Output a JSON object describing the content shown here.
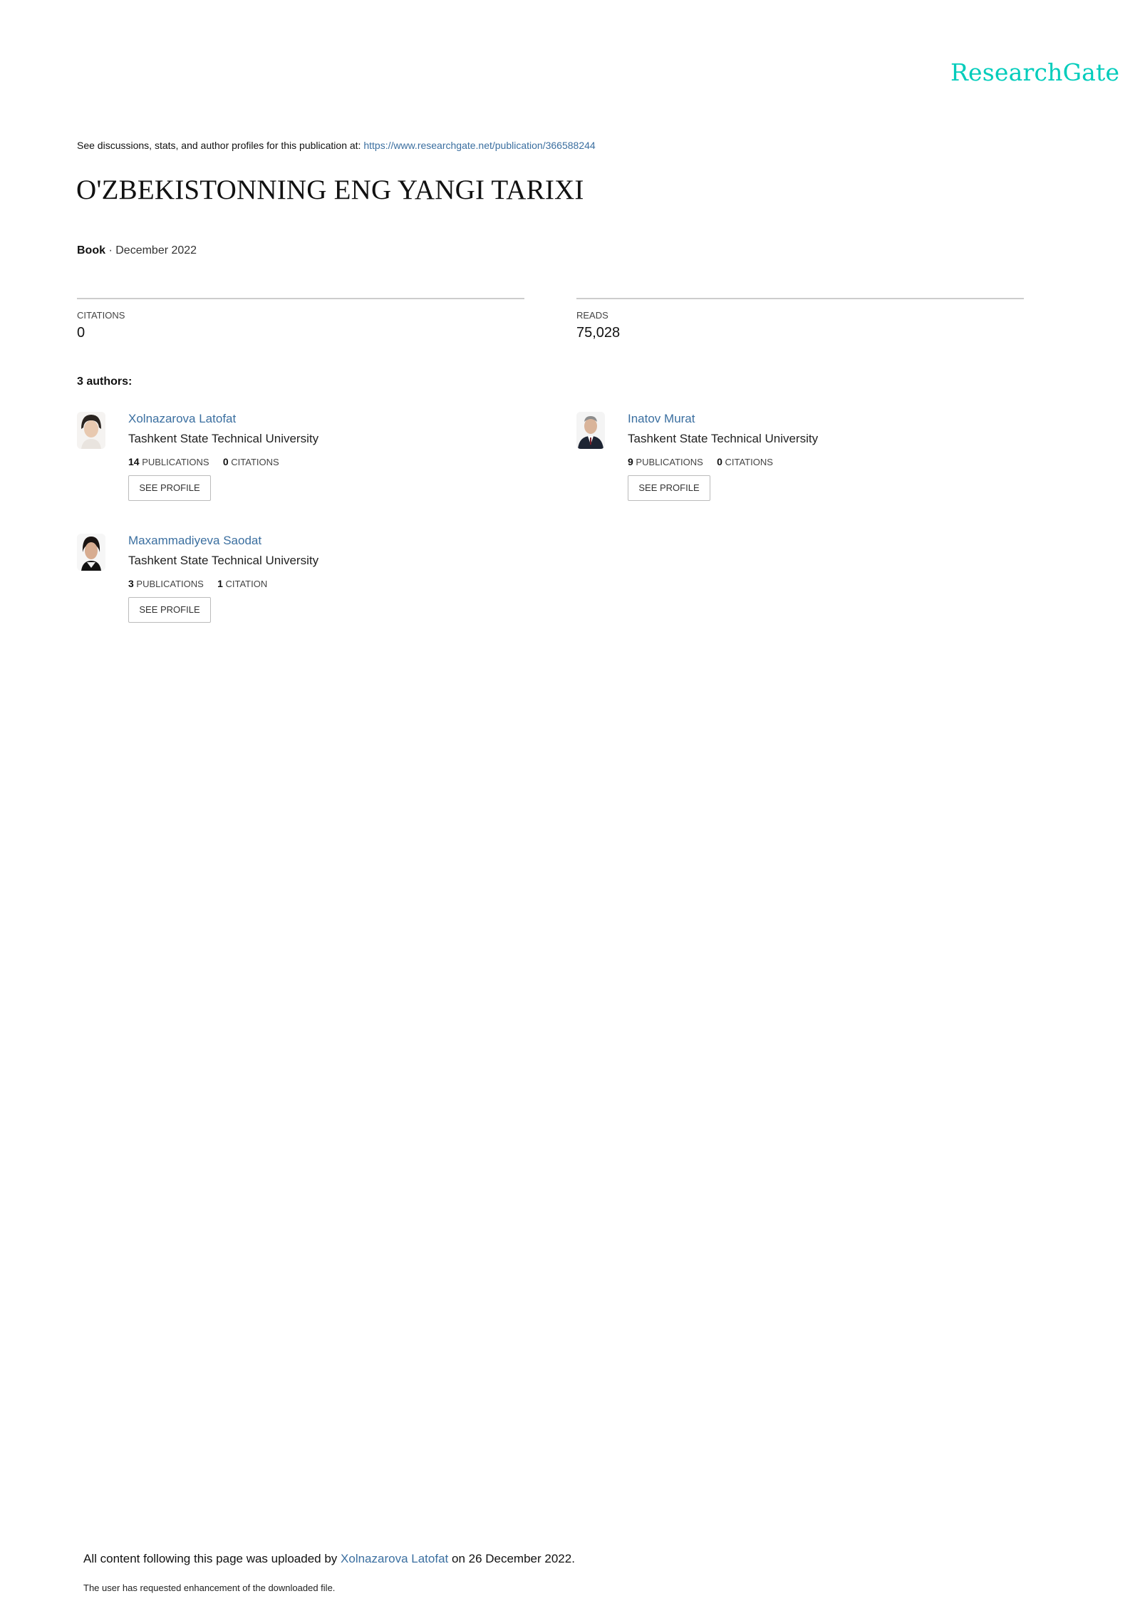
{
  "brand": {
    "logo": "ResearchGate",
    "color": "#00ccbb"
  },
  "header": {
    "discuss_text": "See discussions, stats, and author profiles for this publication at:",
    "url": "https://www.researchgate.net/publication/366588244"
  },
  "publication": {
    "title": "O'ZBEKISTONNING ENG YANGI TARIXI",
    "type": "Book",
    "separator": "·",
    "date": "December 2022"
  },
  "stats": {
    "citations_label": "CITATIONS",
    "citations_value": "0",
    "reads_label": "READS",
    "reads_value": "75,028"
  },
  "authors_heading": "3 authors:",
  "authors": [
    {
      "name": "Xolnazarova Latofat",
      "institution": "Tashkent State Technical University",
      "publications_count": "14",
      "publications_label": "PUBLICATIONS",
      "citations_count": "0",
      "citations_label": "CITATIONS",
      "button": "SEE PROFILE"
    },
    {
      "name": "Inatov Murat",
      "institution": "Tashkent State Technical University",
      "publications_count": "9",
      "publications_label": "PUBLICATIONS",
      "citations_count": "0",
      "citations_label": "CITATIONS",
      "button": "SEE PROFILE"
    },
    {
      "name": "Maxammadiyeva Saodat",
      "institution": "Tashkent State Technical University",
      "publications_count": "3",
      "publications_label": "PUBLICATIONS",
      "citations_count": "1",
      "citations_label": "CITATION",
      "button": "SEE PROFILE"
    }
  ],
  "footer": {
    "prefix": "All content following this page was uploaded by",
    "uploader": "Xolnazarova Latofat",
    "suffix": "on 26 December 2022.",
    "note": "The user has requested enhancement of the downloaded file."
  }
}
